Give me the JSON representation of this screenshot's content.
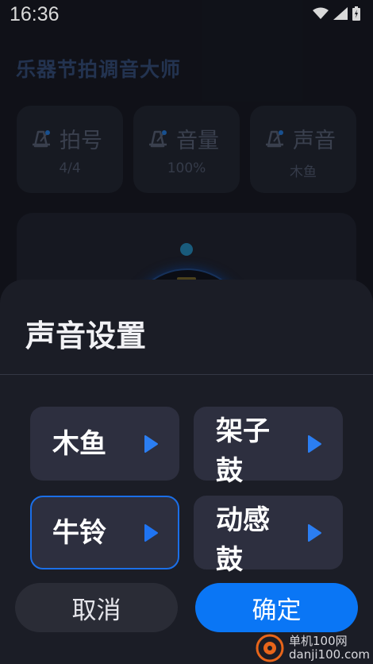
{
  "status_bar": {
    "time": "16:36"
  },
  "app": {
    "title": "乐器节拍调音大师"
  },
  "settings": [
    {
      "label": "拍号",
      "value": "4/4"
    },
    {
      "label": "音量",
      "value": "100%"
    },
    {
      "label": "声音",
      "value": "木鱼"
    }
  ],
  "sheet": {
    "title": "声音设置",
    "options": [
      {
        "label": "木鱼",
        "selected": false
      },
      {
        "label": "架子鼓",
        "selected": false
      },
      {
        "label": "牛铃",
        "selected": true
      },
      {
        "label": "动感鼓",
        "selected": false
      }
    ],
    "cancel_label": "取消",
    "confirm_label": "确定"
  },
  "watermark": {
    "line1": "单机100网",
    "line2": "danji100.com"
  },
  "colors": {
    "accent": "#0a76f5",
    "selected_border": "#1b6fe8",
    "sheet_bg": "#1b1d26",
    "option_bg": "#2d2f3f"
  },
  "icons": {
    "setting": "metronome-icon",
    "play": "play-icon"
  }
}
